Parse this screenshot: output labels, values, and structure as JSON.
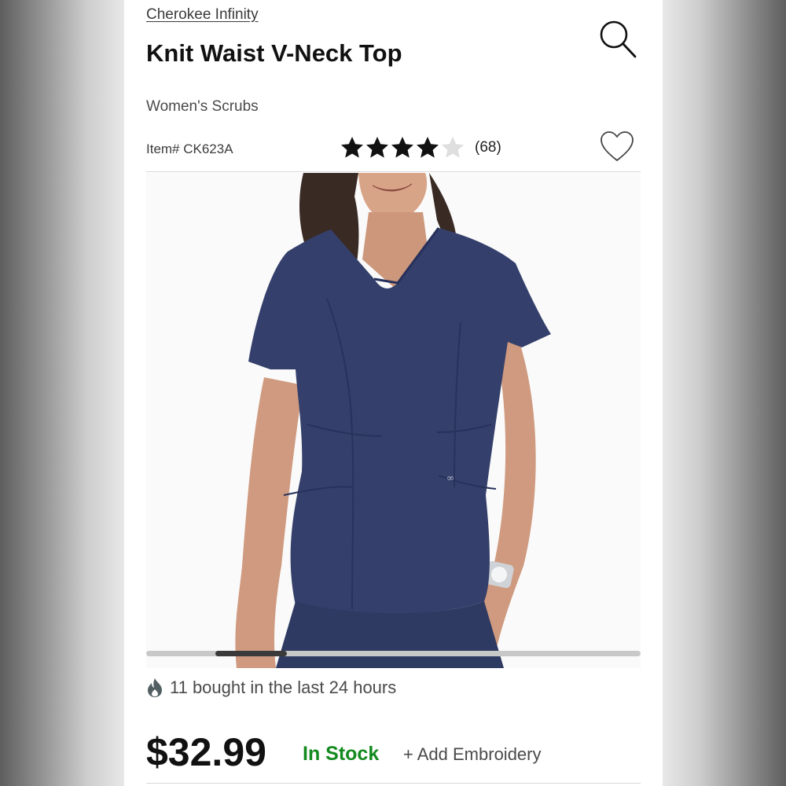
{
  "product": {
    "brand": "Cherokee Infinity",
    "title": "Knit Waist V-Neck Top",
    "category": "Women's Scrubs",
    "item_number": "Item# CK623A",
    "rating": {
      "stars": 4.0,
      "max": 5,
      "count_label": "(68)"
    },
    "social_proof": "11 bought in the last 24 hours",
    "price": "$32.99",
    "stock_status": "In Stock",
    "embroidery_link": "+ Add Embroidery"
  },
  "carousel": {
    "position_start": 0.14,
    "position_end": 0.285
  },
  "icons": {
    "search": "search-icon",
    "favorite": "heart-icon",
    "trending": "fire-icon",
    "star": "star-icon"
  },
  "colors": {
    "in_stock": "#138a1e",
    "scrub_navy": "#34406b",
    "text_dark": "#111111"
  }
}
